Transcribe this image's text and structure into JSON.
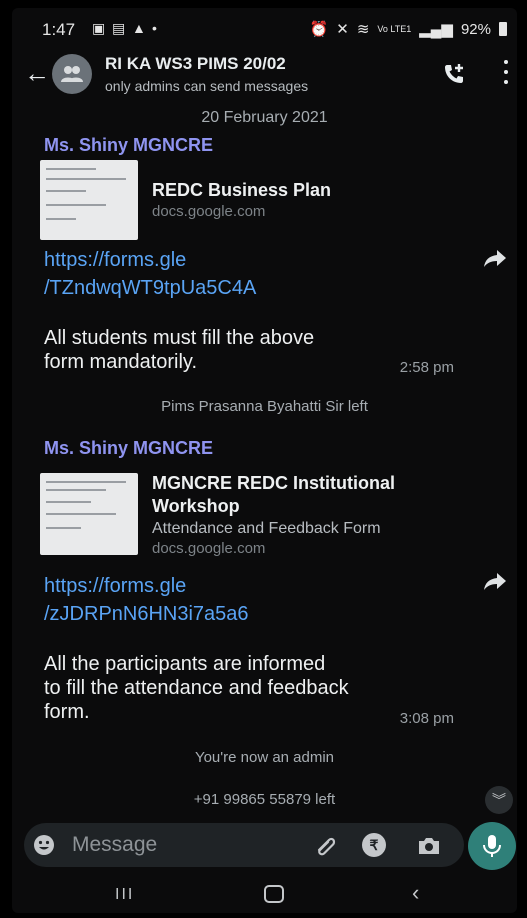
{
  "status_bar": {
    "time": "1:47",
    "battery": "92%",
    "network": "Vo LTE1"
  },
  "header": {
    "title": "RI KA WS3 PIMS 20/02",
    "subtitle": "only admins can send messages"
  },
  "date_separator": "20 February 2021",
  "messages": [
    {
      "sender": "Ms. Shiny MGNCRE",
      "preview_title_lines": [
        "REDC Business Plan"
      ],
      "preview_desc": "",
      "preview_domain": "docs.google.com",
      "link_lines": [
        "https://forms.gle",
        "/TZndwqWT9tpUa5C4A"
      ],
      "text_lines": [
        "All students must fill the above",
        "form mandatorily."
      ],
      "time": "2:58 pm"
    },
    {
      "sender": "Ms. Shiny MGNCRE",
      "preview_title_lines": [
        "MGNCRE REDC Institutional",
        "Workshop"
      ],
      "preview_desc": "Attendance and Feedback Form",
      "preview_domain": "docs.google.com",
      "link_lines": [
        "https://forms.gle",
        "/zJDRPnN6HN3i7a5a6"
      ],
      "text_lines": [
        "All the participants are informed",
        "to fill the attendance and feedback",
        "form."
      ],
      "time": "3:08 pm"
    }
  ],
  "system_messages": {
    "left_1": "Pims Prasanna Byahatti Sir left",
    "admin": "You're now an admin",
    "left_2": "+91 99865 55879 left"
  },
  "composer": {
    "placeholder": "Message"
  },
  "colors": {
    "link": "#5aa4f5",
    "sender": "#8f94f0",
    "mic": "#2f8079"
  }
}
